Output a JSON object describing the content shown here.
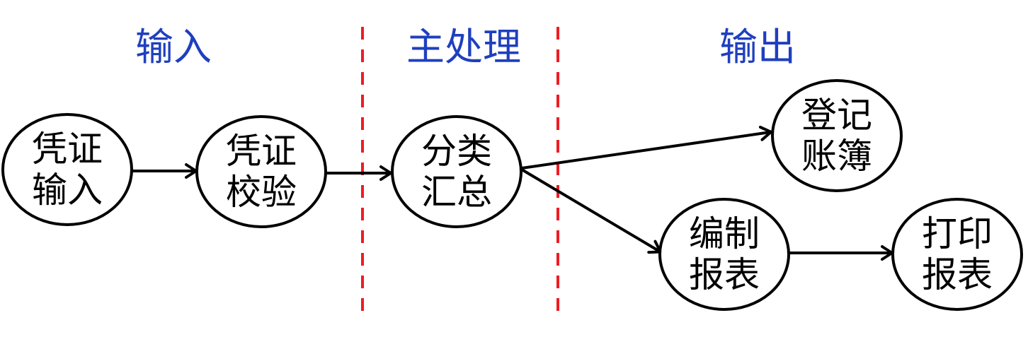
{
  "colors": {
    "section_title": "#1f3fbf",
    "divider": "#ee1c24",
    "node_stroke": "#000000",
    "edge": "#000000",
    "background": "#ffffff"
  },
  "sections": [
    {
      "id": "input",
      "title": "输入"
    },
    {
      "id": "main",
      "title": "主处理"
    },
    {
      "id": "output",
      "title": "输出"
    }
  ],
  "nodes": [
    {
      "id": "voucher-input",
      "line1": "凭证",
      "line2": "输入"
    },
    {
      "id": "voucher-check",
      "line1": "凭证",
      "line2": "校验"
    },
    {
      "id": "classify-summary",
      "line1": "分类",
      "line2": "汇总"
    },
    {
      "id": "register-ledger",
      "line1": "登记",
      "line2": "账簿"
    },
    {
      "id": "compile-report",
      "line1": "编制",
      "line2": "报表"
    },
    {
      "id": "print-report",
      "line1": "打印",
      "line2": "报表"
    }
  ],
  "edges": [
    {
      "from": "voucher-input",
      "to": "voucher-check"
    },
    {
      "from": "voucher-check",
      "to": "classify-summary"
    },
    {
      "from": "classify-summary",
      "to": "register-ledger"
    },
    {
      "from": "classify-summary",
      "to": "compile-report"
    },
    {
      "from": "compile-report",
      "to": "print-report"
    }
  ]
}
